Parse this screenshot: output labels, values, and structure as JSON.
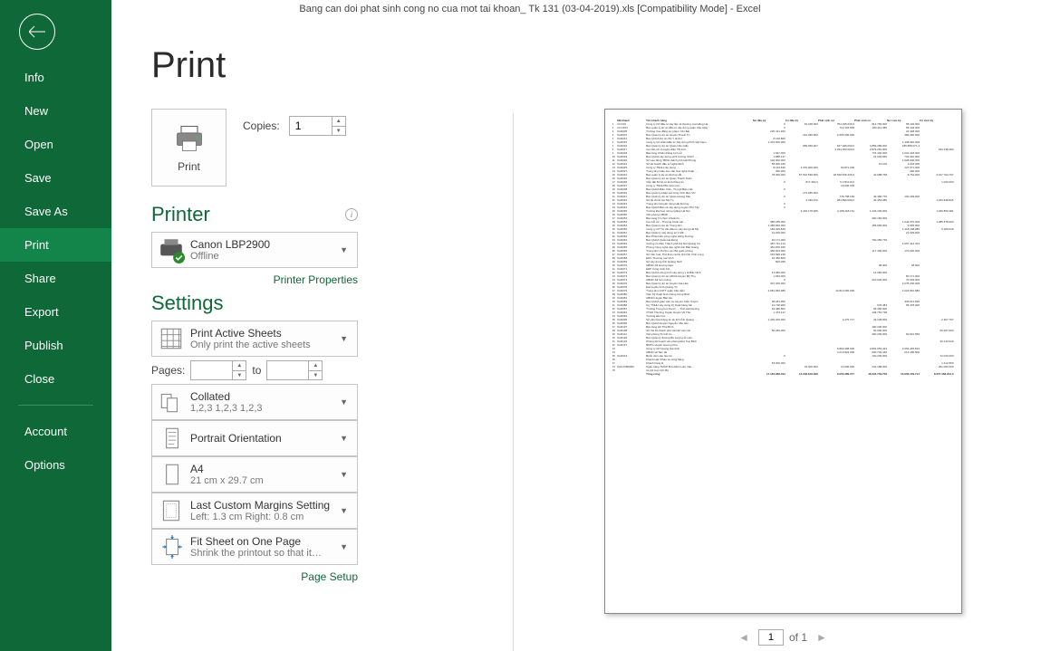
{
  "titlebar": "Bang can doi phat sinh cong no cua mot tai khoan_ Tk 131 (03-04-2019).xls  [Compatibility Mode] - Excel",
  "nav": {
    "info": "Info",
    "new": "New",
    "open": "Open",
    "save": "Save",
    "saveas": "Save As",
    "print": "Print",
    "share": "Share",
    "export": "Export",
    "publish": "Publish",
    "close": "Close",
    "account": "Account",
    "options": "Options"
  },
  "page_title": "Print",
  "print_button": "Print",
  "copies_label": "Copies:",
  "copies_value": "1",
  "printer_heading": "Printer",
  "printer_name": "Canon LBP2900",
  "printer_status": "Offline",
  "printer_properties": "Printer Properties",
  "settings_heading": "Settings",
  "setting_sheets": {
    "l1": "Print Active Sheets",
    "l2": "Only print the active sheets"
  },
  "pages_label": "Pages:",
  "pages_to": "to",
  "setting_collate": {
    "l1": "Collated",
    "l2": "1,2,3    1,2,3    1,2,3"
  },
  "setting_orient": {
    "l1": "Portrait Orientation",
    "l2": ""
  },
  "setting_paper": {
    "l1": "A4",
    "l2": "21 cm x 29.7 cm"
  },
  "setting_margins": {
    "l1": "Last Custom Margins Setting",
    "l2": "Left:   1.3 cm    Right:   0.8 cm"
  },
  "setting_scale": {
    "l1": "Fit Sheet on One Page",
    "l2": "Shrink the printout so that it…"
  },
  "page_setup": "Page Setup",
  "pager": {
    "current": "1",
    "of": "of 1"
  },
  "preview_data": {
    "headers": [
      "",
      "Mã khách",
      "Tên khách hàng",
      "Nợ đầu kỳ",
      "Có đầu kỳ",
      "Phát sinh nợ",
      "Phát sinh có",
      "Nợ cuối kỳ",
      "Có cuối kỳ"
    ],
    "total_row": [
      "",
      "",
      "Tổng cộng",
      "17.184.989.494",
      "16.248.819.098",
      "9.053.389.377",
      "48.294.759.758",
      "16.963.159.714",
      "8.007.368.224,0"
    ],
    "rows": [
      [
        "1",
        "CCC01",
        "Công ty CP đầu tư xây lắp và thương mại Hồng Hà",
        "0",
        "64.438.000",
        "754.335.000,0",
        "814.783.000",
        "58.145.000",
        ""
      ],
      [
        "2",
        "CCC103",
        "Ban quản lý dự án đầu tư xây dựng quận Cầu Giấy",
        "0",
        "",
        "712.334.835",
        "182.411.386",
        "56.148.000",
        ""
      ],
      [
        "3",
        "KH0005",
        "Trường Cao đẳng sư phạm Yên Bái",
        "235.431.200",
        "",
        "",
        "",
        "24.428.000",
        ""
      ],
      [
        "4",
        "KH0007",
        "Ban Quản lý dự án Huyện Thanh Trì",
        "",
        "334.350.500",
        "2.565.600.000",
        "",
        "386.096.600",
        ""
      ],
      [
        "5",
        "KH0012",
        "Ban QLDA Dự án XD Y tế KH",
        "8.130.800",
        "",
        "",
        "",
        "",
        ""
      ],
      [
        "6",
        "KH0015",
        "Công ty Cổ phần Đầu tư Xây dựng PCS Việt Nam",
        "1.391.600.000",
        "",
        "",
        "",
        "1.438.040.000",
        ""
      ],
      [
        "7",
        "KH0016",
        "Ban Quản lý dự án Quận Cầu Giấy",
        "",
        "683.060.207",
        "627.946.000,0",
        "4.859.389.000",
        "186.858.071,3",
        ""
      ],
      [
        "8",
        "KH0017",
        "Cục tần số vô tuyến điện VN kv3",
        "",
        "",
        "3.334.450.000,0",
        "2.879.281.000",
        "",
        "184.338.483"
      ],
      [
        "9",
        "KH0018",
        "Bảo tàng Chiến thắng Lịch sử",
        "1.847.000",
        "",
        "",
        "776.446.000",
        "1.001.418.000",
        ""
      ],
      [
        "10",
        "KH0019",
        "Ban QLDA xây dựng số 5 trường Chinh …",
        "1.888.137",
        "",
        "",
        "31.902.566",
        "702.040.000",
        ""
      ],
      [
        "11",
        "KH0020",
        "Sở Lao động TBXH thành phố Hải Phòng",
        "102.002.000",
        "",
        "",
        "",
        "1.928.000.000",
        ""
      ],
      [
        "12",
        "KH0024",
        "Sở kế hoạch đầu tư Nghệ Định",
        "58.000.183",
        "",
        "",
        "16.100",
        "1.618.005",
        ""
      ],
      [
        "13",
        "KH0025",
        "Công ty TNHH xây dựng …",
        "8.143.630",
        "4.070.000.000",
        "60.871.000",
        "",
        "127.071.000",
        ""
      ],
      [
        "14",
        "KH0027",
        "Trung tâm Giáo dục văn hoá nghệ thuật …",
        "300.000",
        "",
        "",
        "",
        "290.000",
        ""
      ],
      [
        "15",
        "KH0031",
        "Ban quản lý dự án đường sắt …",
        "78.096.000",
        "87.534.599.666",
        "18.528.878.466,0",
        "42.088.768",
        "8.764.000",
        "3.017.794.707"
      ],
      [
        "16",
        "KH0032",
        "Ban Quản lý dự án Quận Thanh Xuân",
        "",
        "",
        "",
        "",
        "",
        ""
      ],
      [
        "17",
        "KH0036",
        "Viễn đài 54 bộ tư lệnh thông tin",
        "0",
        "817.364,0",
        "5.178.010,0",
        "",
        "",
        "1.030.000"
      ],
      [
        "18",
        "KH0037",
        "Công ty TNHH BG Việt nam",
        "",
        "",
        "18.000.000",
        "",
        "",
        ""
      ],
      [
        "19",
        "KH0038",
        "Ban QLDA Biên Chế - Tổ ngũ Bảo mật",
        "0",
        "",
        "",
        "",
        "",
        ""
      ],
      [
        "20",
        "KH0040",
        "Ban Quản lý khảo sát công trình điện VN",
        "",
        "174.486.000",
        "",
        "",
        "",
        ""
      ],
      [
        "21",
        "KH0041",
        "Ban Quản lý dự án Quận Hoàng Mai",
        "0",
        "",
        "778.798.184",
        "49.486.770",
        "100.439.000",
        ""
      ],
      [
        "22",
        "KH0042",
        "Sở tài chính Hà Nội Tp",
        "",
        "4.499.970",
        "284.899.000,0",
        "40.454.385",
        "",
        "1.183.638.846"
      ],
      [
        "23",
        "KH0043",
        "Trung tâm khuyến nông Hải Dương",
        "0",
        "",
        "",
        "",
        "",
        ""
      ],
      [
        "24",
        "KH0044",
        "Ban QLDA Bản vẽ xây dựng huyện Phổ Tây",
        "0",
        "",
        "",
        "",
        "",
        ""
      ],
      [
        "25",
        "KH0045",
        "Trường Đại học nông nghiệp Hà Nội",
        "",
        "3.434.178.486",
        "4.198.218.161",
        "1.443.436.000",
        "",
        "1.180.850.381"
      ],
      [
        "26",
        "KH0050",
        "Văn phòng UBND …",
        "",
        "",
        "",
        "",
        "",
        ""
      ],
      [
        "27",
        "KH0052",
        "Bảo tàng Tổ chức Chuẩn bị …",
        "",
        "",
        "",
        "300.182.000",
        "",
        ""
      ],
      [
        "28",
        "KH0053",
        "Cục Hỗ trợ - Thương Cảnh sát …",
        "385.185.000",
        "",
        "",
        "",
        "1.044.070.000",
        "1.385.678.000"
      ],
      [
        "29",
        "KH0054",
        "Ban Quản lý dự án Trung tâm …",
        "1.385.820.000",
        "",
        "",
        "455.965.000",
        "9.965.000",
        ""
      ],
      [
        "30",
        "KH0060",
        "Công ty CP Tư vấn đầu tư xây dựng Hà Mỹ",
        "183.325.549",
        "",
        "",
        "",
        "1.318.168.286",
        "9.189.549"
      ],
      [
        "31",
        "KH0061",
        "Ban Quản lý xây dựng số 1 MK…",
        "31.029.000",
        "",
        "",
        "",
        "21.029.000",
        ""
      ],
      [
        "32",
        "KH0062",
        "Ban Phát triển công nghệ Hồng Dương",
        "",
        "",
        "",
        "",
        "",
        ""
      ],
      [
        "33",
        "KH0063",
        "Ban QLDA Quận Hà Đông",
        "40.171.000",
        "",
        "",
        "700.459.739",
        "",
        ""
      ],
      [
        "34",
        "KH0064",
        "Xưởng cơ điện Thành phố Hà Nội Quảng Xư",
        "487.741.414",
        "",
        "",
        "",
        "4.067.414.414",
        ""
      ],
      [
        "35",
        "KH0065",
        "Phòng Công nghệ dạy nghề tỉnh Bắc Giang",
        "481.879.466",
        "",
        "",
        "",
        "",
        ""
      ],
      [
        "36",
        "KH0066",
        "Trung tâm US Khu vực Bộ quốc phòng",
        "380.603.000",
        "",
        "",
        "117.400.000",
        "170.020.000",
        ""
      ],
      [
        "37",
        "KH0067",
        "Sở Văn hoá, Thể thao và Du lịch tỉnh Vĩnh Long",
        "315.996.248",
        "",
        "",
        "",
        "",
        ""
      ],
      [
        "38",
        "KH0068",
        "EDC Thương mại Vinh",
        "16.450.800",
        "",
        "",
        "",
        "",
        ""
      ],
      [
        "39",
        "KH0069",
        "Sở xây dựng tỉnh Quảng Ninh",
        "803.295",
        "",
        "",
        "",
        "",
        ""
      ],
      [
        "40",
        "KH0070",
        "UBND Xã Hương Ngà",
        "",
        "",
        "",
        "38.000",
        "38.000",
        ""
      ],
      [
        "41",
        "KH0071",
        "ERP Công trình KH …",
        "",
        "",
        "",
        "",
        "",
        ""
      ],
      [
        "42",
        "KH0072",
        "Ban QLDA công trình xây dựng y tế Bắc Ninh",
        "14.083.000",
        "",
        "",
        "14.083.000",
        "",
        ""
      ],
      [
        "43",
        "KH0073",
        "Ban Quản lý dự án ADGS Huyện Mỹ Thọ",
        "1.933.000",
        "",
        "",
        "",
        "50.171.000",
        ""
      ],
      [
        "44",
        "KH0074",
        "UBND Xã Sơn Cống",
        "0",
        "",
        "",
        "210.000.000",
        "70.303.000",
        ""
      ],
      [
        "45",
        "KH0076",
        "Ban Quản lý dự án Huyện Gia Lâm",
        "307.200.000",
        "",
        "",
        "",
        "2.075.200.000",
        ""
      ],
      [
        "46",
        "KH0078",
        "Đài truyền hình Quảng Trị",
        "",
        "",
        "",
        "",
        "",
        ""
      ],
      [
        "47",
        "KH0079",
        "Trung tâm CNTT quận Cầu diễn",
        "2.081.960.986",
        "",
        "14.813.000.000",
        "",
        "2.224.810.986",
        ""
      ],
      [
        "48",
        "KH0080",
        "Viện Kỹ thuật binh chủng Công Binh",
        "",
        "",
        "",
        "",
        "",
        ""
      ],
      [
        "49",
        "KH0081",
        "UBND Huyện Bắc Hà",
        "",
        "",
        "",
        "",
        "",
        ""
      ],
      [
        "50",
        "KH0083",
        "Ban QLDA giáo viên sự Huyện Cẩm Xuyên",
        "38.261.950",
        "",
        "",
        "",
        "306.511.830",
        ""
      ],
      [
        "51",
        "KH0086",
        "Cty TNHH xây dựng kỹ thuật hàng hải …",
        "12.718.000",
        "",
        "",
        "976.484",
        "65.478.000",
        ""
      ],
      [
        "52",
        "KH0087",
        "Trường Trung học Dược…, Tỉnh Hải Dương",
        "62.486.802",
        "",
        "",
        "66.456.000",
        "",
        ""
      ],
      [
        "53",
        "KH0091",
        "TTGD Thường Xuyên Huyện Vũ Thư",
        "1.473.147",
        "",
        "",
        "136.752.738",
        "",
        ""
      ],
      [
        "54",
        "KH0094",
        "Trường tiểu học …",
        "",
        "",
        "",
        "",
        "",
        ""
      ],
      [
        "55",
        "KH0095",
        "Sở văn hóa thông tin du lịch tỉnh Quảng …",
        "1.430.200.000",
        "",
        "3.170.717",
        "43.248.000",
        "",
        "2.367.797"
      ],
      [
        "56",
        "KH0096",
        "Ban QLDA Huyện Nguyễn Văn tiến…",
        "",
        "",
        "",
        "",
        "",
        ""
      ],
      [
        "57",
        "KH0107",
        "Bảo tàng Hồ Thái Bình",
        "",
        "",
        "",
        "400.200.000",
        "",
        ""
      ],
      [
        "58",
        "KH0108",
        "Sở VH DL thành phố Hà Nội Lào Cai",
        "80.263.000",
        "",
        "",
        "60.000.000",
        "",
        "66.267.000"
      ],
      [
        "59",
        "KH0112",
        "Văn phòng TH Hồ An …",
        "",
        "",
        "",
        "300.200.000",
        "60.901.559",
        ""
      ],
      [
        "60",
        "KH0130",
        "Ban Quản lý đường Bộ Lượng tử Liên…",
        "",
        "",
        "",
        "",
        "",
        ""
      ],
      [
        "61",
        "KH0133",
        "Phòng kế hoạch văn phòng Đức Tuệ Bình",
        "",
        "",
        "",
        "",
        "",
        "30.133.540"
      ],
      [
        "62",
        "KH0137",
        "BMTG Huyện Hương Khê",
        "",
        "",
        "",
        "",
        "",
        ""
      ],
      [
        "63",
        "",
        "Công ty CP Hoang Gia dịnh",
        "",
        "",
        "5.860.398.000",
        "2.802.953.434",
        "3.054.445.816",
        ""
      ],
      [
        "64",
        "",
        "UBND xã Tam đa",
        "",
        "",
        "4.219.823.000",
        "600.702.440",
        "212.186.500",
        ""
      ],
      [
        "65",
        "KH0013",
        "Bệnh viện sản Hà nội",
        "0",
        "",
        "",
        "720.200.000",
        "",
        "72.020.000"
      ],
      [
        "66",
        "",
        "Khách Hàn Khảo vẽ công bằng",
        "",
        "",
        "",
        "",
        "",
        ""
      ],
      [
        "67",
        "",
        "Khách hàng lẻ",
        "53.000.000",
        "",
        "",
        "",
        "",
        "1.412.550"
      ],
      [
        "73",
        "KHLVCB0006",
        "Ngân hàng TMCP Bưu Điện Liên Việt…",
        "",
        "33.000.000",
        "10.000.000",
        "231.188.000",
        "",
        "251.063.000"
      ],
      [
        "75",
        "",
        "Vụ Kế Cục CIC Bộ",
        "",
        "",
        "",
        "",
        "",
        ""
      ]
    ]
  }
}
